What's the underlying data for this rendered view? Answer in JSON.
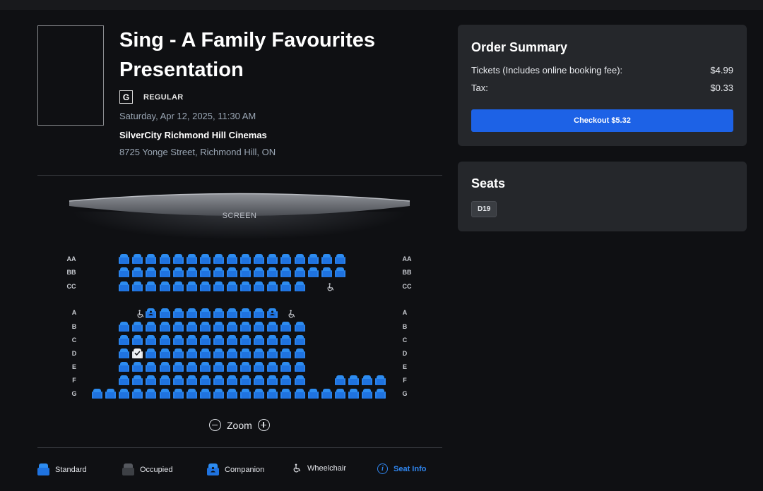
{
  "movie": {
    "title": "Sing - A Family Favourites Presentation",
    "rating": "G",
    "format": "REGULAR",
    "showtime": "Saturday, Apr 12, 2025, 11:30 AM",
    "cinema": "SilverCity Richmond Hill Cinemas",
    "address": "8725 Yonge Street, Richmond Hill, ON"
  },
  "seatmap": {
    "screen_label": "SCREEN",
    "row_labels": [
      "AA",
      "BB",
      "CC",
      "A",
      "B",
      "C",
      "D",
      "E",
      "F",
      "G"
    ],
    "selected_seat": "D19",
    "zoom_label": "Zoom"
  },
  "legend": {
    "standard": "Standard",
    "occupied": "Occupied",
    "companion": "Companion",
    "wheelchair": "Wheelchair",
    "seat_info": "Seat Info"
  },
  "order_summary": {
    "title": "Order Summary",
    "tickets_label": "Tickets (Includes online booking fee):",
    "tickets_value": "$4.99",
    "tax_label": "Tax:",
    "tax_value": "$0.33",
    "checkout_label": "Checkout $5.32"
  },
  "seats_panel": {
    "title": "Seats",
    "seats": [
      "D19"
    ]
  },
  "colors": {
    "accent": "#1d62e6",
    "seat_available": "#2d8cf0",
    "seat_occupied": "#55585e",
    "background": "#0f1013",
    "card": "#25272b"
  },
  "icons": {
    "zoom_out": "minus-circle-icon",
    "zoom_in": "plus-circle-icon",
    "wheelchair": "wheelchair-icon",
    "seat_info": "info-circle-icon"
  }
}
